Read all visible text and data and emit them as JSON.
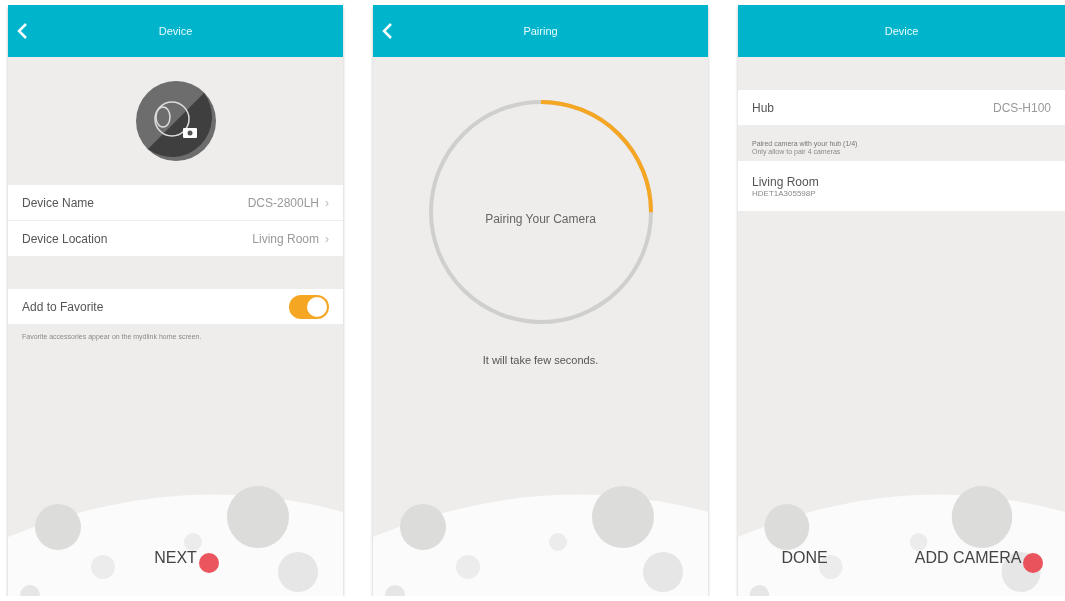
{
  "screens": [
    {
      "kind": "device",
      "title": "Device",
      "back": true,
      "rows": [
        {
          "label": "Device Name",
          "value": "DCS-2800LH",
          "chevron": "›"
        },
        {
          "label": "Device Location",
          "value": "Living Room",
          "chevron": "›"
        }
      ],
      "favorite": {
        "label": "Add to Favorite",
        "on": true
      },
      "note": "Favorite accessories appear on the mydlink home screen.",
      "actions": [
        {
          "label": "NEXT",
          "tapped": true
        }
      ]
    },
    {
      "kind": "pairing",
      "title": "Pairing",
      "back": true,
      "status": "Pairing Your Camera",
      "level": 0.25,
      "hint": "It will take few seconds."
    },
    {
      "kind": "hub",
      "title": "Device",
      "back": false,
      "hub": {
        "label": "Hub",
        "value": "DCS-H100"
      },
      "section": {
        "title": "Paired camera with your hub (1/4)",
        "subtitle": "Only allow to pair 4 cameras"
      },
      "cameras": [
        {
          "name": "Living Room",
          "serial": "HDET1A305598P"
        }
      ],
      "actions": [
        {
          "label": "DONE",
          "tapped": false
        },
        {
          "label": "ADD CAMERA",
          "tapped": true
        }
      ]
    }
  ]
}
